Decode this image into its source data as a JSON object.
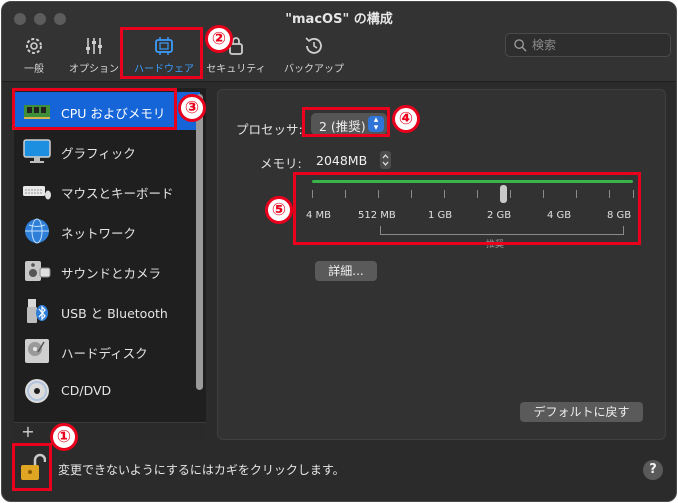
{
  "window": {
    "title": "\"macOS\" の構成"
  },
  "toolbar": {
    "tabs": [
      {
        "label": "一般",
        "icon": "gear-icon"
      },
      {
        "label": "オプション",
        "icon": "sliders-icon"
      },
      {
        "label": "ハードウェア",
        "icon": "chip-icon",
        "active": true
      },
      {
        "label": "セキュリティ",
        "icon": "lock-icon"
      },
      {
        "label": "バックアップ",
        "icon": "clock-back-icon"
      }
    ],
    "search_placeholder": "検索"
  },
  "sidebar": {
    "items": [
      {
        "label": "CPU およびメモリ",
        "icon": "memory-chip-icon",
        "active": true
      },
      {
        "label": "グラフィック",
        "icon": "monitor-icon"
      },
      {
        "label": "マウスとキーボード",
        "icon": "keyboard-icon"
      },
      {
        "label": "ネットワーク",
        "icon": "globe-icon"
      },
      {
        "label": "サウンドとカメラ",
        "icon": "speaker-icon"
      },
      {
        "label": "USB と Bluetooth",
        "icon": "usb-bluetooth-icon"
      },
      {
        "label": "ハードディスク",
        "icon": "hard-disk-icon"
      },
      {
        "label": "CD/DVD",
        "icon": "disc-icon"
      }
    ],
    "add_label": "+"
  },
  "settings": {
    "processor_label": "プロセッサ:",
    "processor_value": "2 (推奨)",
    "memory_label": "メモリ:",
    "memory_value": "2048MB",
    "memory_slider": {
      "ticks": [
        "4 MB",
        "512 MB",
        "1 GB",
        "2 GB",
        "4 GB",
        "8 GB"
      ],
      "selected": "2 GB",
      "recommended_label": "推奨",
      "track_color": "#39b44a"
    },
    "details_button": "詳細...",
    "default_button": "デフォルトに戻す"
  },
  "footer": {
    "lock_text": "変更できないようにするにはカギをクリックします。",
    "help_label": "?"
  },
  "annotations": {
    "color": "#e8001c",
    "markers": [
      "①",
      "②",
      "③",
      "④",
      "⑤"
    ]
  }
}
